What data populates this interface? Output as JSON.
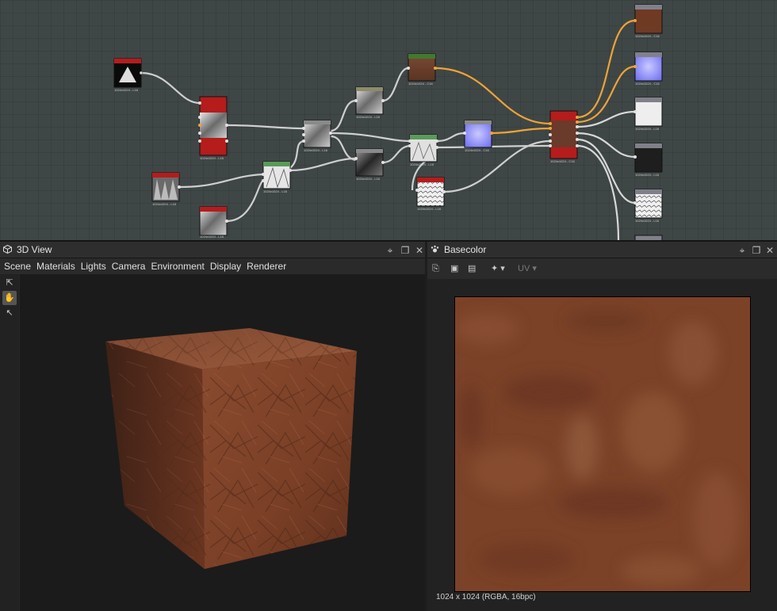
{
  "graph": {
    "node_labels": {
      "n_gradient": "1024x1024 - L16",
      "n_blend_red": "1024x1024 - L16",
      "n_noise_a": "1024x1024 - L16",
      "n_noise_b": "1024x1024 - L16",
      "n_noise_c": "1024x1024 - L16",
      "n_noise_d": "1024x1024 - L16",
      "n_brown": "1024x1024 - C16",
      "n_green_mix": "1024x1024 - L16",
      "n_green_mix2": "1024x1024 - L16",
      "n_normal": "1024x1024 - C16",
      "n_white_red": "1024x1024 - L16",
      "n_shape": "1024x1024 - L16",
      "n_grunge": "1024x1024 - L16",
      "n_material": "1024x1024 - C16",
      "o_basecolor": "1024x1024 - C16",
      "o_normal": "1024x1024 - C16",
      "o_roughness": "1024x1024 - L16",
      "o_metallic": "1024x1024 - L16",
      "o_height": "1024x1024 - L16"
    },
    "colors": {
      "active_wire": "#f0a336",
      "wire": "#d4d4d4",
      "node_red": "#b51c1c",
      "node_green": "#5a9a5a"
    }
  },
  "view3d": {
    "title": "3D View",
    "menu": [
      "Scene",
      "Materials",
      "Lights",
      "Camera",
      "Environment",
      "Display",
      "Renderer"
    ],
    "tool_icons": [
      "export-icon",
      "hand-icon",
      "cursor-icon"
    ]
  },
  "view2d": {
    "title": "Basecolor",
    "toolbar_icons": [
      "copy-icon",
      "save-icon",
      "camera-icon",
      "share-icon"
    ],
    "uv_label": "UV",
    "texture_info": "1024 x 1024 (RGBA, 16bpc)"
  }
}
